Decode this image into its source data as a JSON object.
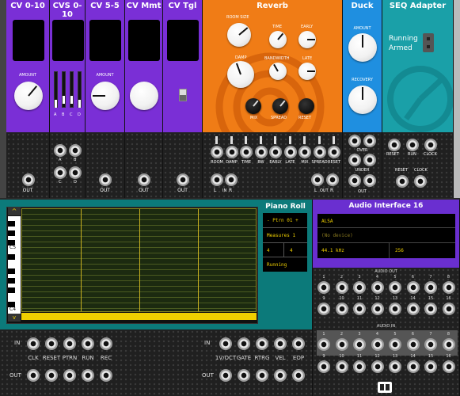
{
  "modules": {
    "cv010": {
      "title": "CV 0-10",
      "amount": "AMOUNT",
      "out": "OUT"
    },
    "cvs010": {
      "title": "CVS 0-10",
      "sliders": [
        "A",
        "B",
        "C",
        "D"
      ],
      "jacks": [
        "A",
        "B",
        "C",
        "D"
      ],
      "out": "OUT"
    },
    "cv55": {
      "title": "CV 5-5",
      "amount": "AMOUNT",
      "out": "OUT"
    },
    "cvmmt": {
      "title": "CV Mmt",
      "out": "OUT"
    },
    "cvtgl": {
      "title": "CV Tgl",
      "out": "OUT"
    },
    "reverb": {
      "title": "Reverb",
      "knobs": {
        "room_size": "ROOM SIZE",
        "time": "TIME",
        "early": "EARLY",
        "damp": "DAMP",
        "bandwidth": "BANDWIDTH",
        "late": "LATE",
        "mix": "MIX",
        "spread": "SPREAD",
        "reset": "RESET"
      },
      "cv_labels": [
        "ROOM",
        "DAMP",
        "TIME",
        "BW",
        "EARLY",
        "LATE",
        "MIX",
        "SPREAD",
        "RESET"
      ],
      "in_label": "IN",
      "out_label": "OUT",
      "l": "L",
      "r": "R"
    },
    "duck": {
      "title": "Duck",
      "amount": "AMOUNT",
      "recovery": "RECOVERY",
      "over": "OVER",
      "under": "UNDER",
      "out": "OUT"
    },
    "seq": {
      "title": "SEQ Adapter",
      "status1": "Running",
      "status2": "Armed",
      "reset": "RESET",
      "run": "RUN",
      "clock": "CLOCK"
    },
    "pianoroll": {
      "title": "Piano Roll",
      "pattern": "- Ptrn 01 +",
      "measures": "Measures 1",
      "beats1": "4",
      "beats2": "4",
      "status": "Running",
      "c5": "C5",
      "c4": "C4",
      "in": "IN",
      "out": "OUT",
      "left_labels": [
        "CLK",
        "RESET",
        "PTRN",
        "RUN",
        "REC"
      ],
      "right_labels": [
        "1V/OCT",
        "GATE",
        "RTRG",
        "VEL",
        "EOP"
      ]
    },
    "audio": {
      "title": "Audio Interface 16",
      "driver": "ALSA",
      "device": "(No device)",
      "rate": "44.1 kHz",
      "block": "256",
      "out_label": "AUDIO OUT",
      "in_label": "AUDIO IN",
      "nums": [
        "1",
        "2",
        "3",
        "4",
        "5",
        "6",
        "7",
        "8",
        "9",
        "10",
        "11",
        "12",
        "13",
        "14",
        "15",
        "16"
      ]
    }
  },
  "colors": {
    "purple": "#7a2fd6",
    "orange": "#f07c16",
    "blue": "#1f8fe0",
    "teal": "#1aa0a8",
    "piano": "#0c7a7a",
    "audio": "#6a2fd0",
    "yellow": "#f0d000"
  }
}
